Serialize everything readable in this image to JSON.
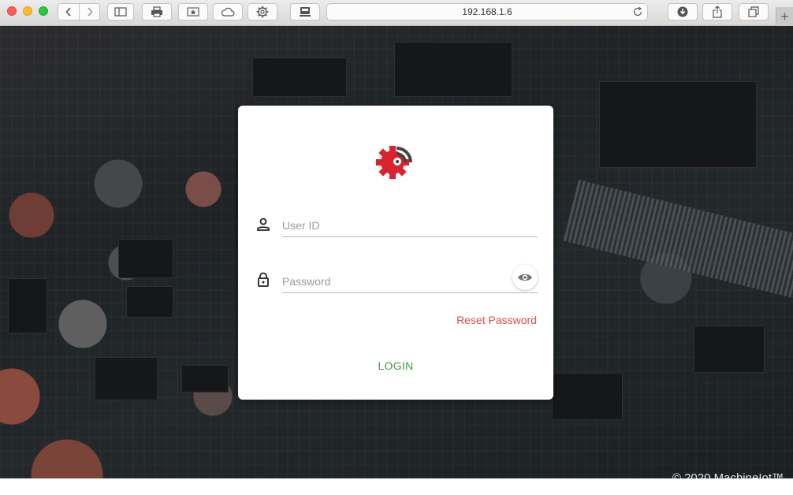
{
  "browser": {
    "address": "192.168.1.6",
    "icons": [
      "back-chevron-icon",
      "forward-chevron-icon",
      "sidebar-icon",
      "print-icon",
      "bookmark-star-icon",
      "cloud-icon",
      "gear-icon",
      "screen-icon",
      "reload-icon",
      "download-icon",
      "share-icon",
      "tabs-icon",
      "plus-icon"
    ],
    "newtab_label": "+"
  },
  "login": {
    "user_id_placeholder": "User ID",
    "password_placeholder": "Password",
    "reset_label": "Reset Password",
    "login_label": "LOGIN",
    "logo_color": "#d9232d",
    "accent_green": "#4a9b43",
    "link_red": "#d94d4d"
  },
  "footer": {
    "copyright": "© 2020 MachineIot™"
  }
}
